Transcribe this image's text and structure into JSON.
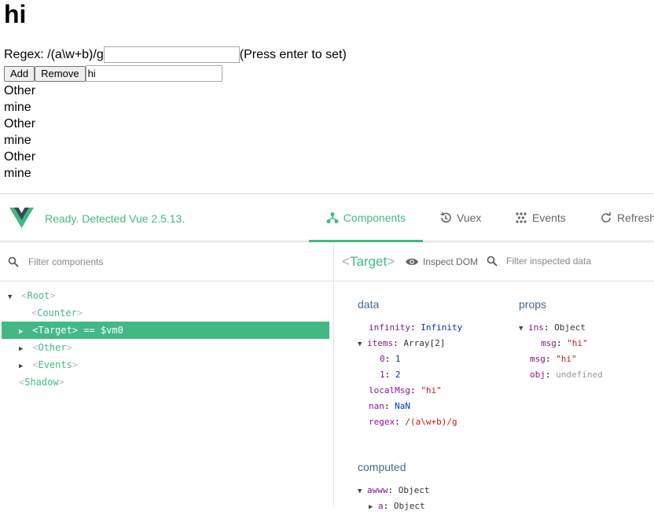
{
  "page": {
    "heading": "hi",
    "regex_label": "Regex: /(a\\w+b)/g",
    "regex_input_value": "",
    "regex_hint": "(Press enter to set)",
    "add_label": "Add",
    "remove_label": "Remove",
    "text_input_value": "hi",
    "items": [
      "Other",
      "mine",
      "Other",
      "mine",
      "Other",
      "mine"
    ]
  },
  "devtools": {
    "status": "Ready. Detected Vue 2.5.13.",
    "tabs": [
      {
        "label": "Components",
        "icon": "components-icon",
        "active": true
      },
      {
        "label": "Vuex",
        "icon": "history-icon",
        "active": false
      },
      {
        "label": "Events",
        "icon": "events-icon",
        "active": false
      },
      {
        "label": "Refresh",
        "icon": "refresh-icon",
        "active": false
      }
    ],
    "filter_components_placeholder": "Filter components",
    "tree": [
      {
        "name": "Root",
        "expanded": true,
        "selected": false
      },
      {
        "name": "Counter",
        "expanded": null,
        "selected": false
      },
      {
        "name": "Target",
        "expanded": false,
        "selected": true,
        "vm": "== $vm0"
      },
      {
        "name": "Other",
        "expanded": false,
        "selected": false
      },
      {
        "name": "Events",
        "expanded": false,
        "selected": false
      },
      {
        "name": "Shadow",
        "expanded": null,
        "selected": false
      }
    ],
    "inspector": {
      "title": "Target",
      "inspect_dom_label": "Inspect DOM",
      "filter_placeholder": "Filter inspected data",
      "data_title": "data",
      "data": {
        "infinity_key": "infinity",
        "infinity_val": "Infinity",
        "items_key": "items",
        "items_val": "Array[2]",
        "item0_key": "0",
        "item0_val": "1",
        "item1_key": "1",
        "item1_val": "2",
        "localMsg_key": "localMsg",
        "localMsg_val": "\"hi\"",
        "nan_key": "nan",
        "nan_val": "NaN",
        "regex_key": "regex",
        "regex_val": "/(a\\w+b)/g"
      },
      "props_title": "props",
      "props": {
        "ins_key": "ins",
        "ins_val": "Object",
        "ins_msg_key": "msg",
        "ins_msg_val": "\"hi\"",
        "msg_key": "msg",
        "msg_val": "\"hi\"",
        "obj_key": "obj",
        "obj_val": "undefined"
      },
      "computed_title": "computed",
      "computed": {
        "awww_key": "awww",
        "awww_val": "Object",
        "a_key": "a",
        "a_val": "Object"
      }
    },
    "colors": {
      "accent": "#42b983",
      "key": "#881391",
      "number": "#0033cc",
      "string": "#c41a16"
    }
  }
}
